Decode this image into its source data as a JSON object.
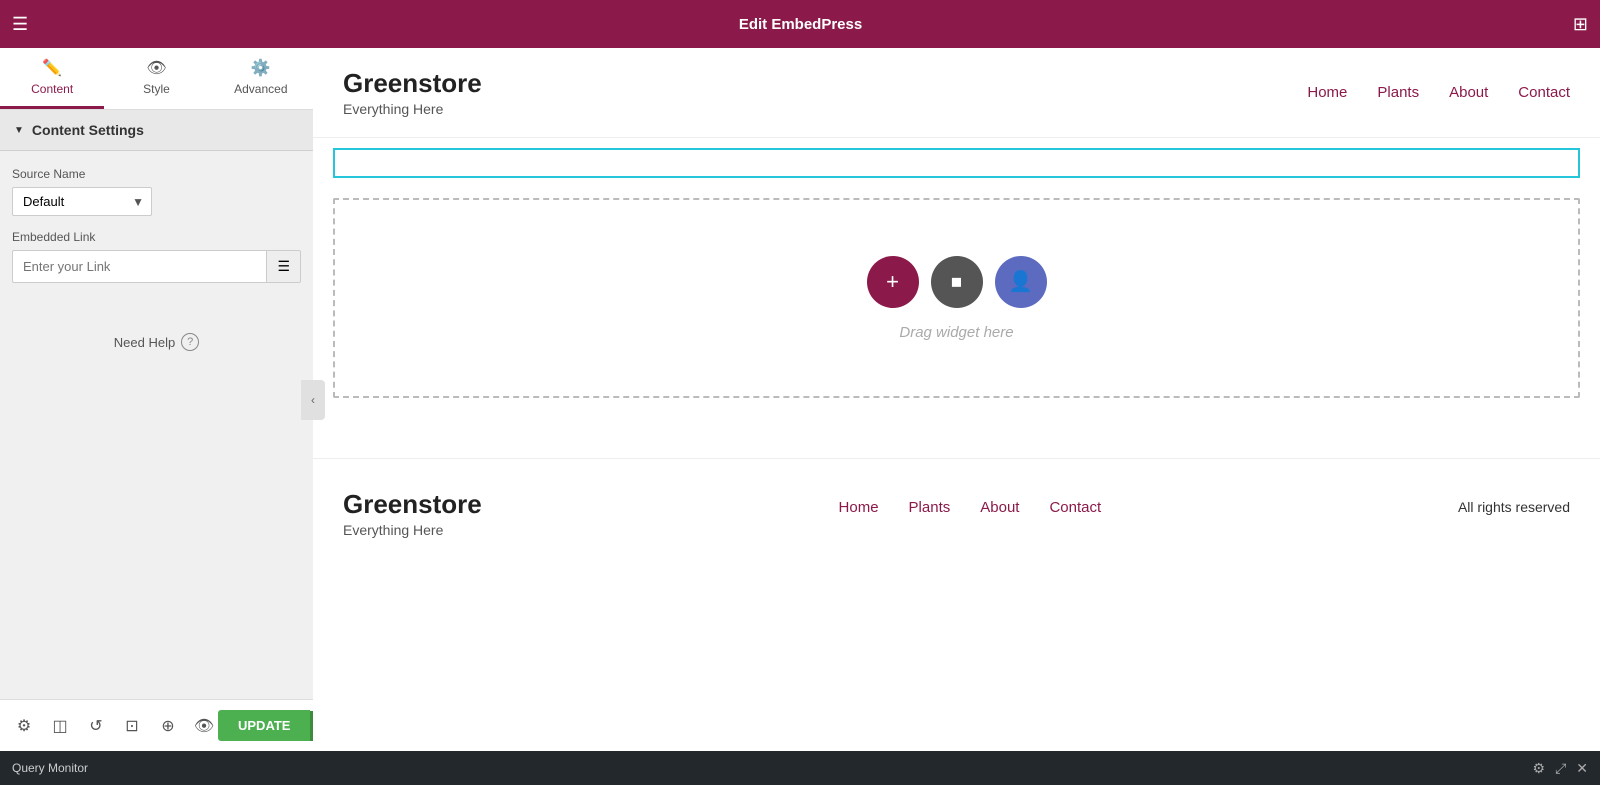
{
  "topbar": {
    "title": "Edit EmbedPress",
    "hamburger": "☰",
    "grid": "⊞"
  },
  "tabs": [
    {
      "id": "content",
      "label": "Content",
      "icon": "✏️",
      "active": true
    },
    {
      "id": "style",
      "label": "Style",
      "icon": "👁",
      "active": false
    },
    {
      "id": "advanced",
      "label": "Advanced",
      "icon": "⚙️",
      "active": false
    }
  ],
  "contentSettings": {
    "heading": "Content Settings",
    "sourceNameLabel": "Source Name",
    "sourceNameDefault": "Default",
    "sourceNameOptions": [
      "Default"
    ],
    "embeddedLinkLabel": "Embedded Link",
    "embeddedLinkPlaceholder": "Enter your Link",
    "needHelp": "Need Help"
  },
  "bottomToolbar": {
    "updateLabel": "UPDATE"
  },
  "siteHeader": {
    "logoName": "Greenstore",
    "logoTagline": "Everything Here",
    "navItems": [
      "Home",
      "Plants",
      "About",
      "Contact"
    ]
  },
  "widgetArea": {
    "dragHint": "Drag widget here"
  },
  "siteFooter": {
    "logoName": "Greenstore",
    "logoTagline": "Everything Here",
    "navItems": [
      "Home",
      "Plants",
      "About",
      "Contact"
    ],
    "rights": "All rights reserved"
  },
  "queryMonitor": {
    "label": "Query Monitor"
  }
}
